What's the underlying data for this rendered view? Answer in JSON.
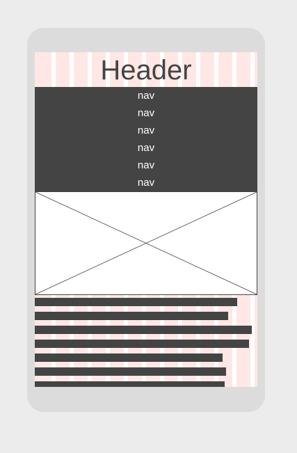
{
  "header": {
    "title": "Header"
  },
  "nav": {
    "items": [
      {
        "label": "nav"
      },
      {
        "label": "nav"
      },
      {
        "label": "nav"
      },
      {
        "label": "nav"
      },
      {
        "label": "nav"
      },
      {
        "label": "nav"
      }
    ]
  },
  "image": {
    "icon": "image-placeholder-cross"
  },
  "colors": {
    "background": "#ececec",
    "frame": "#dcdcdc",
    "dark": "#444444",
    "grid_column": "#ffe7e5",
    "text_on_dark": "#ffffff"
  }
}
